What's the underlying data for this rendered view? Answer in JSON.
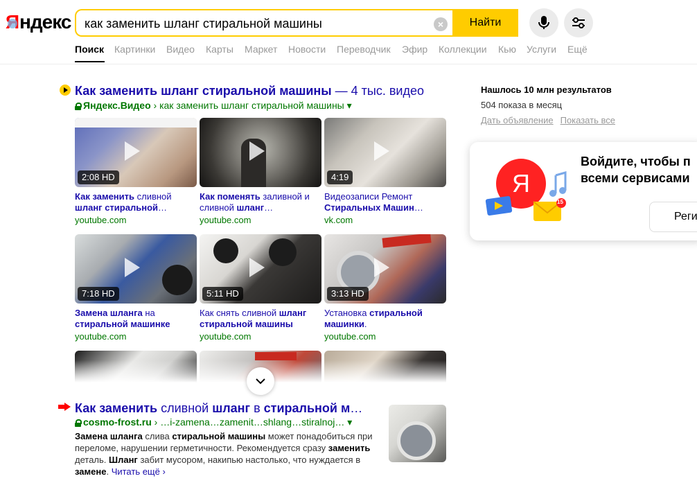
{
  "logo": {
    "text_red": "Я",
    "text_black": "ндекс"
  },
  "search": {
    "query": "как заменить шланг стиральной машины",
    "find_label": "Найти",
    "clear_glyph": "×"
  },
  "nav": {
    "items": [
      {
        "label": "Поиск",
        "active": true
      },
      {
        "label": "Картинки"
      },
      {
        "label": "Видео"
      },
      {
        "label": "Карты"
      },
      {
        "label": "Маркет"
      },
      {
        "label": "Новости"
      },
      {
        "label": "Переводчик"
      },
      {
        "label": "Эфир"
      },
      {
        "label": "Коллекции"
      },
      {
        "label": "Кью"
      },
      {
        "label": "Услуги"
      },
      {
        "label": "Ещё"
      }
    ]
  },
  "video_block": {
    "title_bold": "Как заменить шланг стиральной машины",
    "title_count": " — 4 тыс. видео",
    "source_bold": "Яндекс.Видео",
    "source_path": " › как заменить шланг стиральной машины ▾",
    "videos": [
      {
        "duration": "2:08 HD",
        "caption_html": "<b>Как заменить</b> сливной <b>шланг стиральной</b>…",
        "source": "youtube.com"
      },
      {
        "duration": "",
        "caption_html": "<b>Как поменять</b> заливной и сливной <b>шланг</b>…",
        "source": "youtube.com"
      },
      {
        "duration": "4:19",
        "caption_html": "Видеозаписи Ремонт <b>Стиральных Машин</b>…",
        "source": "vk.com"
      },
      {
        "duration": "7:18 HD",
        "caption_html": "<b>Замена шланга</b> на <b>стиральной машинке</b>",
        "source": "youtube.com"
      },
      {
        "duration": "5:11 HD",
        "caption_html": "Как снять сливной <b>шланг стиральной машины</b>",
        "source": "youtube.com"
      },
      {
        "duration": "3:13 HD",
        "caption_html": "Установка <b>стиральной машинки</b>.",
        "source": "youtube.com"
      }
    ]
  },
  "result": {
    "title_html": "<b>Как заменить</b> сливной <b>шланг</b> в <b>стиральной м</b>…",
    "host": "cosmo-frost.ru",
    "path": " › …i-zamena…zamenit…shlang…stiralnoj… ▾",
    "snippet_html": "<b>Замена шланга</b> слива <b>стиральной машины</b> может понадобиться при переломе, нарушении герметичности. Рекомендуется сразу <b>заменить</b> деталь. <b>Шланг</b> забит мусором, накипью настолько, что нуждается в <b>замене</b>. ",
    "more": "Читать ещё ›"
  },
  "sidebar": {
    "found": "Нашлось 10 млн результатов",
    "shows": "504 показа в месяц",
    "ad_link": "Дать объявление",
    "all_link": "Показать все",
    "login_line1": "Войдите, чтобы п",
    "login_line2": "всеми сервисами",
    "register": "Реги",
    "mail_badge": "15"
  }
}
